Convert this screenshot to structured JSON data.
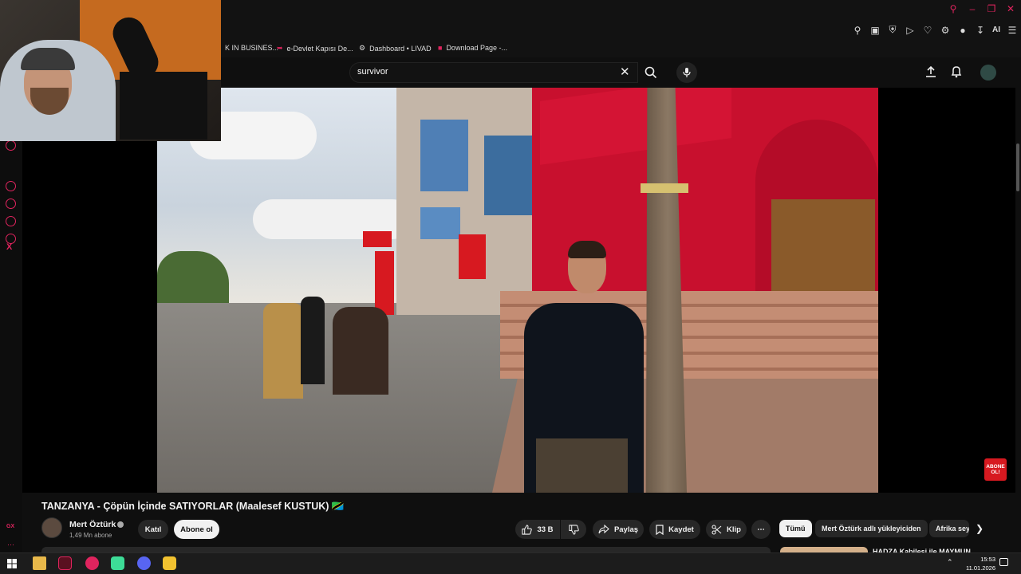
{
  "bookmarks": [
    {
      "label": "K IN BUSINES...",
      "icon": "globe-icon"
    },
    {
      "label": "e-Devlet Kapısı De...",
      "icon": "edevlet-icon"
    },
    {
      "label": "Dashboard • LIVAD",
      "icon": "dashboard-icon"
    },
    {
      "label": "Download Page -...",
      "icon": "download-page-icon"
    }
  ],
  "toolbar": {
    "ai_label": "AI"
  },
  "search": {
    "query": "survivor"
  },
  "video": {
    "title": "TANZANYA - Çöpün İçinde SATIYORLAR (Maalesef KUSTUK) 🇹🇿",
    "overlay_badge": "ABONE OL!"
  },
  "channel": {
    "name": "Mert Öztürk",
    "subscribers": "1,49 Mn abone",
    "join_label": "Katıl",
    "subscribe_label": "Abone ol"
  },
  "actions": {
    "likes": "33 B",
    "share_label": "Paylaş",
    "save_label": "Kaydet",
    "clip_label": "Klip"
  },
  "chips": [
    "Tümü",
    "Mert Öztürk adlı yükleyiciden",
    "Afrika sey"
  ],
  "recommendation": {
    "title": "HADZA Kabilesi ile MAYMUN..."
  },
  "sidebar": {
    "gx_label": "GX",
    "x_label": "X"
  },
  "taskbar": {
    "time": "15:53",
    "date": "11.01.2026"
  },
  "colors": {
    "accent": "#e0245e",
    "yt_background": "#0f0f0f",
    "subscribe_bg": "#f1f1f1"
  }
}
